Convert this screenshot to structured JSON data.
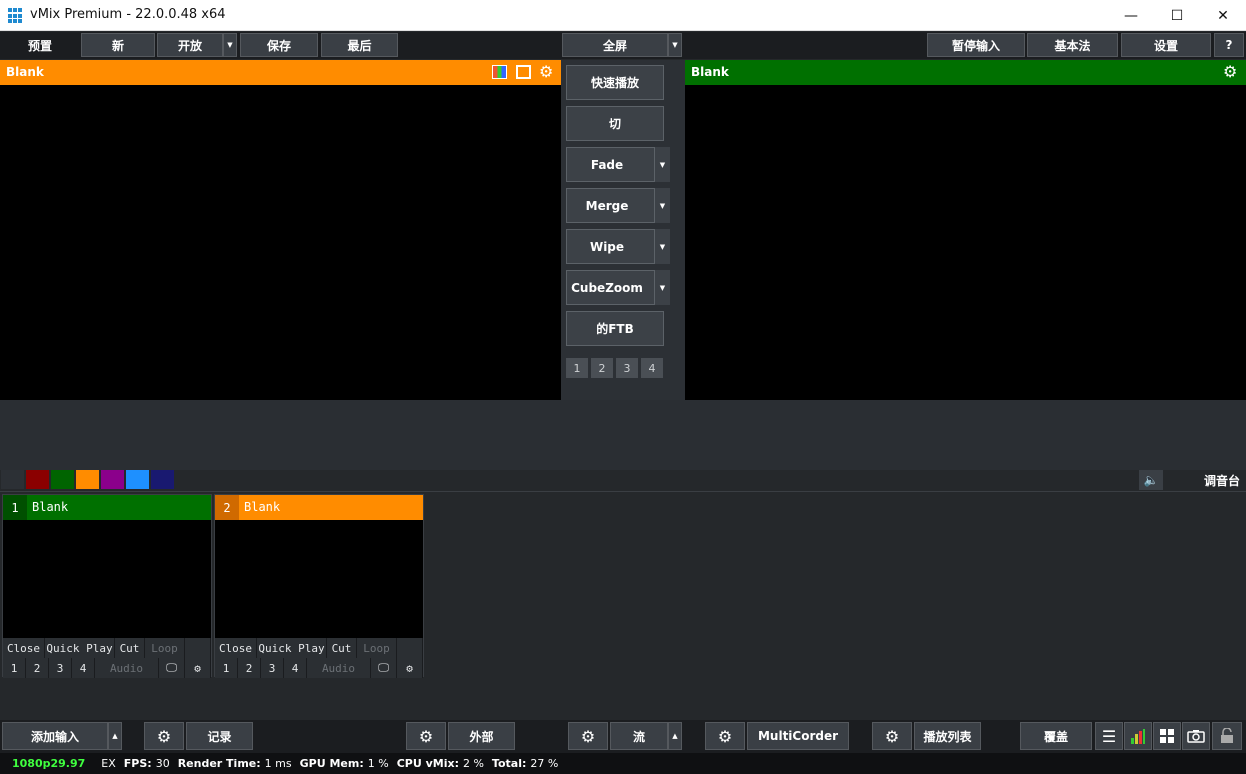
{
  "window": {
    "title": "vMix Premium - 22.0.0.48 x64",
    "minimize": "—",
    "maximize": "☐",
    "close": "✕"
  },
  "menubar": {
    "preview": "预置",
    "new": "新",
    "open": "开放",
    "save": "保存",
    "last": "最后",
    "fullscreen": "全屏",
    "pause_input": "暂停输入",
    "basic": "基本法",
    "settings": "设置",
    "help": "?"
  },
  "preview_pane": {
    "label": "Blank",
    "color": "#ff8c00"
  },
  "output_pane": {
    "label": "Blank",
    "color": "#007000"
  },
  "transitions": {
    "quick_play": "快速播放",
    "cut": "切",
    "items": [
      "Fade",
      "Merge",
      "Wipe",
      "CubeZoom"
    ],
    "ftb": "的FTB",
    "numbers": [
      "1",
      "2",
      "3",
      "4"
    ]
  },
  "colors": {
    "swatches": [
      "#2c3035",
      "#8b0000",
      "#006400",
      "#ff8c00",
      "#8b008b",
      "#1e90ff",
      "#191970"
    ],
    "accent_orange": "#ff8c00",
    "accent_green": "#007000"
  },
  "audio_mixer": {
    "label": "调音台",
    "icon": "speaker-icon"
  },
  "inputs": [
    {
      "number": "1",
      "name": "Blank",
      "color": "#007000",
      "controls": [
        "Close",
        "Quick Play",
        "Cut",
        "Loop"
      ],
      "overlays": [
        "1",
        "2",
        "3",
        "4"
      ],
      "audio": "Audio"
    },
    {
      "number": "2",
      "name": "Blank",
      "color": "#ff8c00",
      "controls": [
        "Close",
        "Quick Play",
        "Cut",
        "Loop"
      ],
      "overlays": [
        "1",
        "2",
        "3",
        "4"
      ],
      "audio": "Audio"
    }
  ],
  "bottombar": {
    "add_input": "添加输入",
    "record": "记录",
    "external": "外部",
    "stream": "流",
    "multicorder": "MultiCorder",
    "playlist": "播放列表",
    "overlay": "覆盖"
  },
  "status": {
    "format": "1080p29.97",
    "ex": "EX",
    "fps_label": "FPS:",
    "fps": "30",
    "render_label": "Render Time:",
    "render": "1 ms",
    "gpu_label": "GPU Mem:",
    "gpu": "1 %",
    "cpu_label": "CPU vMix:",
    "cpu": "2 %",
    "total_label": "Total:",
    "total": "27 %"
  }
}
